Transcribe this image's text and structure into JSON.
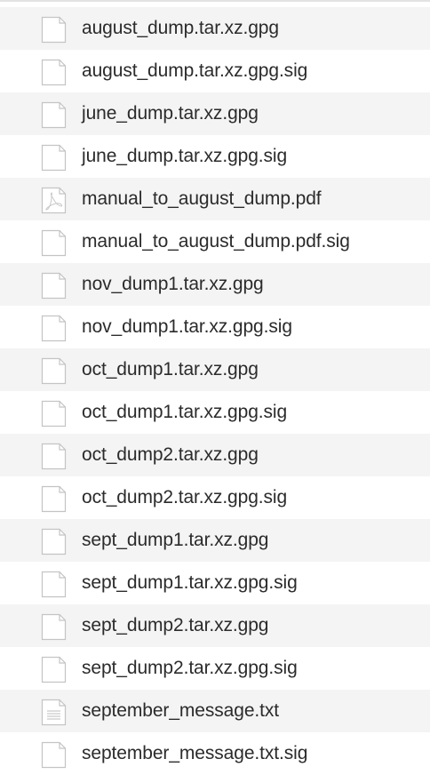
{
  "files": [
    {
      "name": "august_dump.tar.xz.gpg",
      "icon": "generic-file-icon"
    },
    {
      "name": "august_dump.tar.xz.gpg.sig",
      "icon": "generic-file-icon"
    },
    {
      "name": "june_dump.tar.xz.gpg",
      "icon": "generic-file-icon"
    },
    {
      "name": "june_dump.tar.xz.gpg.sig",
      "icon": "generic-file-icon"
    },
    {
      "name": "manual_to_august_dump.pdf",
      "icon": "pdf-file-icon"
    },
    {
      "name": "manual_to_august_dump.pdf.sig",
      "icon": "generic-file-icon"
    },
    {
      "name": "nov_dump1.tar.xz.gpg",
      "icon": "generic-file-icon"
    },
    {
      "name": "nov_dump1.tar.xz.gpg.sig",
      "icon": "generic-file-icon"
    },
    {
      "name": "oct_dump1.tar.xz.gpg",
      "icon": "generic-file-icon"
    },
    {
      "name": "oct_dump1.tar.xz.gpg.sig",
      "icon": "generic-file-icon"
    },
    {
      "name": "oct_dump2.tar.xz.gpg",
      "icon": "generic-file-icon"
    },
    {
      "name": "oct_dump2.tar.xz.gpg.sig",
      "icon": "generic-file-icon"
    },
    {
      "name": "sept_dump1.tar.xz.gpg",
      "icon": "generic-file-icon"
    },
    {
      "name": "sept_dump1.tar.xz.gpg.sig",
      "icon": "generic-file-icon"
    },
    {
      "name": "sept_dump2.tar.xz.gpg",
      "icon": "generic-file-icon"
    },
    {
      "name": "sept_dump2.tar.xz.gpg.sig",
      "icon": "generic-file-icon"
    },
    {
      "name": "september_message.txt",
      "icon": "text-file-icon"
    },
    {
      "name": "september_message.txt.sig",
      "icon": "generic-file-icon"
    }
  ],
  "colors": {
    "stripe": "#f4f4f5",
    "text": "#2b2b2b",
    "icon_stroke": "#c4c4c4"
  }
}
